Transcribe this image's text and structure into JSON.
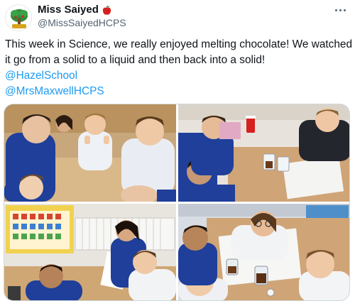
{
  "author": {
    "display_name": "Miss Saiyed",
    "handle": "@MissSaiyedHCPS",
    "name_emoji": "apple-emoji-icon"
  },
  "post": {
    "text_line_1": "This week in Science, we really enjoyed melting chocolate! We watched",
    "text_line_2": "it go from a solid to a liquid and then back into a solid!",
    "mentions": [
      "@HazelSchool",
      "@MrsMaxwellHCPS"
    ]
  },
  "colors": {
    "mention": "#1d9bf0",
    "handle": "#536471",
    "uniform_blue": "#1f3f9a",
    "apple_red": "#d62020"
  },
  "media": {
    "photos": [
      {
        "name": "photo-children-thumbs-up"
      },
      {
        "name": "photo-children-with-cups"
      },
      {
        "name": "photo-classroom-girl-and-boys"
      },
      {
        "name": "photo-children-with-jars"
      }
    ]
  }
}
